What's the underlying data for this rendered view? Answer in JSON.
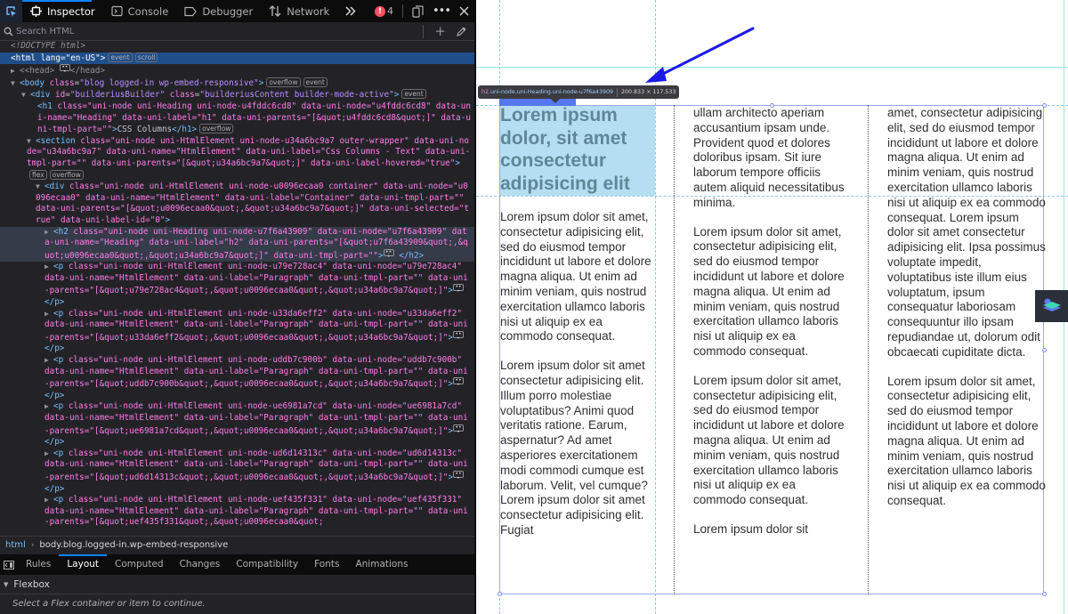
{
  "devtools": {
    "toolbar": {
      "tabs": [
        {
          "label": "Inspector",
          "icon": "inspector-icon",
          "active": true
        },
        {
          "label": "Console",
          "icon": "console-icon",
          "active": false
        },
        {
          "label": "Debugger",
          "icon": "debugger-icon",
          "active": false
        },
        {
          "label": "Network",
          "icon": "network-icon",
          "active": false
        }
      ],
      "more_tools_icon": "double-chevron-icon",
      "error_count": "4",
      "error_icon": "error-icon",
      "responsive_icon": "responsive-design-icon",
      "menu_icon": "more-options-icon",
      "close_icon": "close-icon"
    },
    "search": {
      "placeholder": "Search HTML",
      "value": "",
      "add_node_icon": "plus-icon",
      "eyedropper_icon": "eyedropper-icon"
    },
    "markup": {
      "doctype": "<!DOCTYPE html>",
      "html_open": "<html lang=\"en-US\">",
      "html_badges": [
        "event",
        "scroll"
      ],
      "head": "<head>",
      "head_close": "</head>",
      "body_tag": "body",
      "body_attr": "class",
      "body_val": "\"blog logged-in wp-embed-responsive\"",
      "body_badges": [
        "overflow",
        "event"
      ],
      "div_builder": {
        "tag": "div",
        "id": "\"builderiusBuilder\"",
        "class": "\"builderiusContent builder-mode-active\"",
        "badge": "event"
      },
      "h1": {
        "tag": "h1",
        "attrs": "class=\"uni-node uni-Heading uni-node-u4fddc6cd8\" data-uni-node=\"u4fddc6cd8\" data-uni-name=\"Heading\" data-uni-label=\"h1\" data-uni-parents=\"[&quot;u4fddc6cd8&quot;]\" data-uni-tmpl-part=\"\"",
        "text": "CSS Columns",
        "badge": "overflow"
      },
      "section": {
        "tag": "section",
        "attrs": "class=\"uni-node uni-HtmlElement uni-node-u34a6bc9a7 outer-wrapper\" data-uni-node=\"u34a6bc9a7\" data-uni-name=\"HtmlElement\" data-uni-label=\"Css Columns - Text\" data-uni-tmpl-part=\"\" data-uni-parents=\"[&quot;u34a6bc9a7&quot;]\" data-uni-label-hovered=\"true\"",
        "badges": [
          "flex",
          "overflow"
        ]
      },
      "container": {
        "tag": "div",
        "attrs": "class=\"uni-node uni-HtmlElement uni-node-u0096ecaa0 container\" data-uni-node=\"u0096ecaa0\" data-uni-name=\"HtmlElement\" data-uni-label=\"Container\" data-uni-tmpl-part=\"\" data-uni-parents=\"[&quot;u0096ecaa0&quot;,&quot;u34a6bc9a7&quot;]\" data-uni-selected=\"true\" data-uni-label-id=\"0\""
      },
      "h2": {
        "tag": "h2",
        "attrs": "class=\"uni-node uni-Heading uni-node-u7f6a43909\" data-uni-node=\"u7f6a43909\" data-uni-name=\"Heading\" data-uni-label=\"h2\" data-uni-parents=\"[&quot;u7f6a43909&quot;,&quot;u0096ecaa0&quot;,&quot;u34a6bc9a7&quot;]\" data-uni-tmpl-part=\"\""
      },
      "paragraphs": [
        {
          "tag": "p",
          "attrs": "class=\"uni-node uni-HtmlElement uni-node-u79e728ac4\" data-uni-node=\"u79e728ac4\" data-uni-name=\"HtmlElement\" data-uni-label=\"Paragraph\" data-uni-tmpl-part=\"\" data-uni-parents=\"[&quot;u79e728ac4&quot;,&quot;u0096ecaa0&quot;,&quot;u34a6bc9a7&quot;]\""
        },
        {
          "tag": "p",
          "attrs": "class=\"uni-node uni-HtmlElement uni-node-u33da6eff2\" data-uni-node=\"u33da6eff2\" data-uni-name=\"HtmlElement\" data-uni-label=\"Paragraph\" data-uni-tmpl-part=\"\" data-uni-parents=\"[&quot;u33da6eff2&quot;,&quot;u0096ecaa0&quot;,&quot;u34a6bc9a7&quot;]\""
        },
        {
          "tag": "p",
          "attrs": "class=\"uni-node uni-HtmlElement uni-node-uddb7c900b\" data-uni-node=\"uddb7c900b\" data-uni-name=\"HtmlElement\" data-uni-label=\"Paragraph\" data-uni-tmpl-part=\"\" data-uni-parents=\"[&quot;uddb7c900b&quot;,&quot;u0096ecaa0&quot;,&quot;u34a6bc9a7&quot;]\""
        },
        {
          "tag": "p",
          "attrs": "class=\"uni-node uni-HtmlElement uni-node-ue6981a7cd\" data-uni-node=\"ue6981a7cd\" data-uni-name=\"HtmlElement\" data-uni-label=\"Paragraph\" data-uni-tmpl-part=\"\" data-uni-parents=\"[&quot;ue6981a7cd&quot;,&quot;u0096ecaa0&quot;,&quot;u34a6bc9a7&quot;]\""
        },
        {
          "tag": "p",
          "attrs": "class=\"uni-node uni-HtmlElement uni-node-ud6d14313c\" data-uni-node=\"ud6d14313c\" data-uni-name=\"HtmlElement\" data-uni-label=\"Paragraph\" data-uni-tmpl-part=\"\" data-uni-parents=\"[&quot;ud6d14313c&quot;,&quot;u0096ecaa0&quot;,&quot;u34a6bc9a7&quot;]\""
        },
        {
          "tag": "p",
          "attrs": "class=\"uni-node uni-HtmlElement uni-node-uef435f331\" data-uni-node=\"uef435f331\" data-uni-name=\"HtmlElement\" data-uni-label=\"Paragraph\" data-uni-tmpl-part=\"\" data-uni-parents=\"[&quot;uef435f331&quot;,&quot;u0096ecaa0&quot;"
        }
      ]
    },
    "breadcrumb": {
      "root": "html",
      "current": "body.blog.logged-in.wp-embed-responsive"
    },
    "sidebar_tabs": [
      "Rules",
      "Layout",
      "Computed",
      "Changes",
      "Compatibility",
      "Fonts",
      "Animations"
    ],
    "sidebar_active": "Layout",
    "flexbox": {
      "title": "Flexbox",
      "message": "Select a Flex container or item to continue."
    }
  },
  "page": {
    "tooltip": {
      "tag": "h2",
      "classes": ".uni-node.uni-Heading.uni-node-u7f6a43909",
      "size": "200.833 × 117.533"
    },
    "heading": "Lorem ipsum dolor, sit amet consectetur adipisicing elit",
    "columns": [
      [
        "Lorem ipsum dolor sit amet, consectetur adipisicing elit, sed do eiusmod tempor incididunt ut labore et dolore magna aliqua. Ut enim ad minim veniam, quis nostrud exercitation ullamco laboris nisi ut aliquip ex ea commodo consequat.",
        "Lorem ipsum dolor sit amet consectetur adipisicing elit. Illum porro molestiae voluptatibus? Animi quod veritatis ratione. Earum, aspernatur? Ad amet asperiores exercitationem modi commodi cumque est laborum. Velit, vel cumque? Lorem ipsum dolor sit amet consectetur adipisicing elit. Fugiat"
      ],
      [
        "ullam architecto aperiam accusantium ipsam unde. Provident quod et dolores doloribus ipsam. Sit iure laborum tempore officiis autem aliquid necessitatibus minima.",
        "Lorem ipsum dolor sit amet, consectetur adipisicing elit, sed do eiusmod tempor incididunt ut labore et dolore magna aliqua. Ut enim ad minim veniam, quis nostrud exercitation ullamco laboris nisi ut aliquip ex ea commodo consequat.",
        "Lorem ipsum dolor sit amet, consectetur adipisicing elit, sed do eiusmod tempor incididunt ut labore et dolore magna aliqua. Ut enim ad minim veniam, quis nostrud exercitation ullamco laboris nisi ut aliquip ex ea commodo consequat.",
        "Lorem ipsum dolor sit"
      ],
      [
        "amet, consectetur adipisicing elit, sed do eiusmod tempor incididunt ut labore et dolore magna aliqua. Ut enim ad minim veniam, quis nostrud exercitation ullamco laboris nisi ut aliquip ex ea commodo consequat. Lorem ipsum dolor sit amet consectetur adipisicing elit. Ipsa possimus voluptate impedit, voluptatibus iste illum eius voluptatum, ipsum consequatur laboriosam consequuntur illo ipsam repudiandae ut, dolorum odit obcaecati cupiditate dicta.",
        "Lorem ipsum dolor sit amet, consectetur adipisicing elit, sed do eiusmod tempor incididunt ut labore et dolore magna aliqua. Ut enim ad minim veniam, quis nostrud exercitation ullamco laboris nisi ut aliquip ex ea commodo consequat."
      ]
    ],
    "builder_button_icon": "layers-icon",
    "annotation_arrow": "arrow-annotation",
    "colors": {
      "highlight": "#b6def2",
      "guide": "#8cc7e8",
      "container_outline": "#9aa7f5",
      "arrow": "#1a1ae6"
    }
  }
}
